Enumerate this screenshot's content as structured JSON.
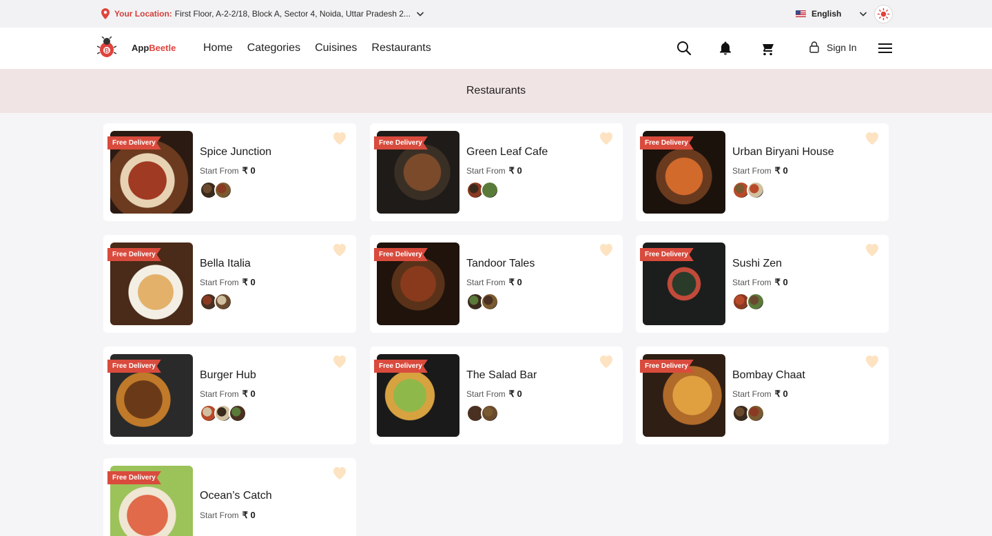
{
  "topbar": {
    "location_label": "Your Location:",
    "location_value": "First Floor, A-2-2/18, Block A, Sector 4, Noida, Uttar Pradesh 2...",
    "language": "English"
  },
  "header": {
    "logo_prefix": "App",
    "logo_suffix": "Beetle",
    "nav": [
      "Home",
      "Categories",
      "Cuisines",
      "Restaurants"
    ],
    "signin": "Sign In"
  },
  "banner": {
    "title": "Restaurants"
  },
  "restaurants": [
    {
      "name": "Spice Junction",
      "badge": "Free Delivery",
      "start_label": "Start From",
      "price": "₹ 0",
      "cuisines": 2
    },
    {
      "name": "Green Leaf Cafe",
      "badge": "Free Delivery",
      "start_label": "Start From",
      "price": "₹ 0",
      "cuisines": 2
    },
    {
      "name": "Urban Biryani House",
      "badge": "Free Delivery",
      "start_label": "Start From",
      "price": "₹ 0",
      "cuisines": 2
    },
    {
      "name": "Bella Italia",
      "badge": "Free Delivery",
      "start_label": "Start From",
      "price": "₹ 0",
      "cuisines": 2
    },
    {
      "name": "Tandoor Tales",
      "badge": "Free Delivery",
      "start_label": "Start From",
      "price": "₹ 0",
      "cuisines": 2
    },
    {
      "name": "Sushi Zen",
      "badge": "Free Delivery",
      "start_label": "Start From",
      "price": "₹ 0",
      "cuisines": 2
    },
    {
      "name": "Burger Hub",
      "badge": "Free Delivery",
      "start_label": "Start From",
      "price": "₹ 0",
      "cuisines": 3
    },
    {
      "name": "The Salad Bar",
      "badge": "Free Delivery",
      "start_label": "Start From",
      "price": "₹ 0",
      "cuisines": 2
    },
    {
      "name": "Bombay Chaat",
      "badge": "Free Delivery",
      "start_label": "Start From",
      "price": "₹ 0",
      "cuisines": 2
    },
    {
      "name": "Ocean’s Catch",
      "badge": "Free Delivery",
      "start_label": "Start From",
      "price": "₹ 0",
      "cuisines": 0
    }
  ],
  "colors": {
    "accent": "#d94b3d",
    "banner_bg": "#f1e4e4",
    "heart": "#fde3c2"
  }
}
